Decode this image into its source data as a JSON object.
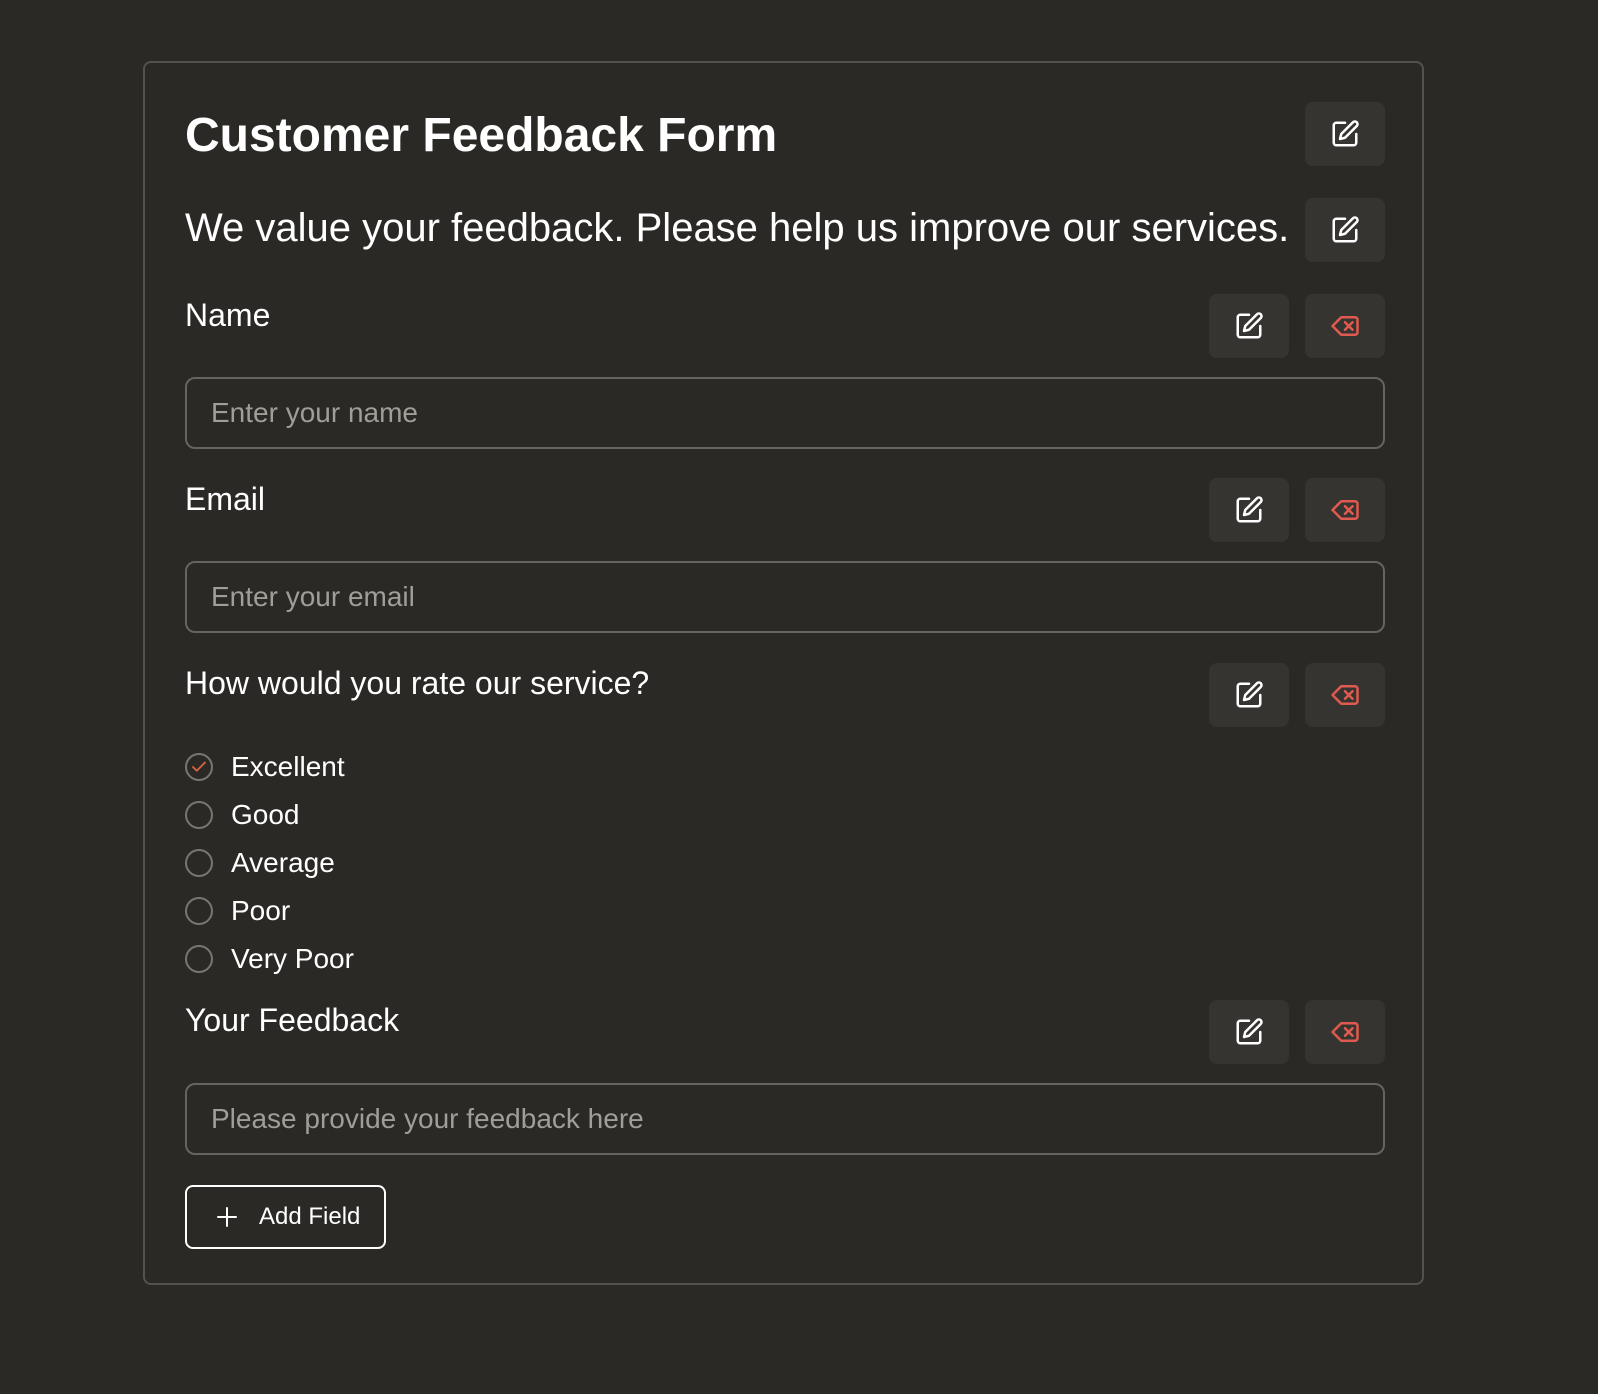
{
  "form": {
    "title": "Customer Feedback Form",
    "description": "We value your feedback. Please help us improve our services."
  },
  "fields": {
    "name": {
      "label": "Name",
      "placeholder": "Enter your name"
    },
    "email": {
      "label": "Email",
      "placeholder": "Enter your email"
    },
    "rating": {
      "label": "How would you rate our service?",
      "options": [
        "Excellent",
        "Good",
        "Average",
        "Poor",
        "Very Poor"
      ],
      "selected": "Excellent"
    },
    "feedback": {
      "label": "Your Feedback",
      "placeholder": "Please provide your feedback here"
    }
  },
  "actions": {
    "add_field_label": "Add Field"
  },
  "icons": {
    "edit": "edit-icon",
    "delete": "delete-icon",
    "check": "check-icon",
    "plus": "plus-icon"
  },
  "colors": {
    "background": "#2a2926",
    "border": "#55524d",
    "button_bg": "#363430",
    "delete_accent": "#e05a4f",
    "check_accent": "#d9623c"
  }
}
